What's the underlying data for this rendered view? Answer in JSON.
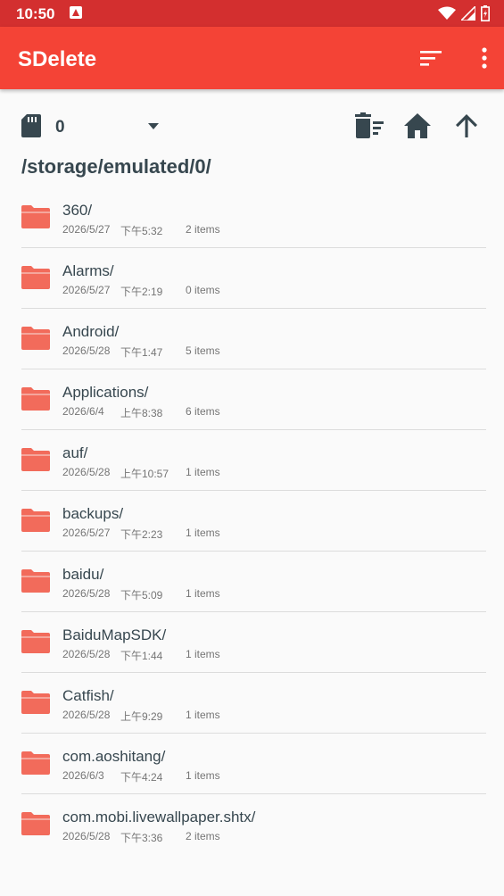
{
  "status_bar": {
    "time": "10:50"
  },
  "app_bar": {
    "title": "SDelete"
  },
  "storage": {
    "selected": "0"
  },
  "path": "/storage/emulated/0/",
  "colors": {
    "status_bar": "#d32f2f",
    "app_bar": "#f44336",
    "folder": "#f26b5b",
    "text": "#37474f"
  },
  "items": [
    {
      "name": "360/",
      "date": "2026/5/27",
      "time": "下午5:32",
      "count": "2 items"
    },
    {
      "name": "Alarms/",
      "date": "2026/5/27",
      "time": "下午2:19",
      "count": "0 items"
    },
    {
      "name": "Android/",
      "date": "2026/5/28",
      "time": "下午1:47",
      "count": "5 items"
    },
    {
      "name": "Applications/",
      "date": "2026/6/4",
      "time": "上午8:38",
      "count": "6 items"
    },
    {
      "name": "auf/",
      "date": "2026/5/28",
      "time": "上午10:57",
      "count": "1 items"
    },
    {
      "name": "backups/",
      "date": "2026/5/27",
      "time": "下午2:23",
      "count": "1 items"
    },
    {
      "name": "baidu/",
      "date": "2026/5/28",
      "time": "下午5:09",
      "count": "1 items"
    },
    {
      "name": "BaiduMapSDK/",
      "date": "2026/5/28",
      "time": "下午1:44",
      "count": "1 items"
    },
    {
      "name": "Catfish/",
      "date": "2026/5/28",
      "time": "上午9:29",
      "count": "1 items"
    },
    {
      "name": "com.aoshitang/",
      "date": "2026/6/3",
      "time": "下午4:24",
      "count": "1 items"
    },
    {
      "name": "com.mobi.livewallpaper.shtx/",
      "date": "2026/5/28",
      "time": "下午3:36",
      "count": "2 items"
    }
  ]
}
